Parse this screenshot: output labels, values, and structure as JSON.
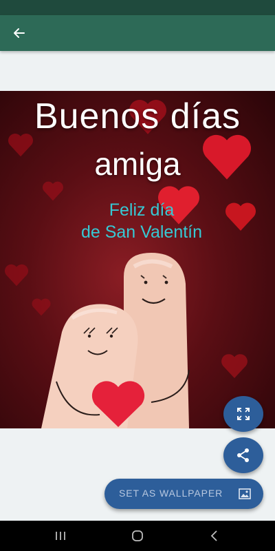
{
  "app_bar": {
    "back_icon": "arrow-back-icon",
    "color": "#2d6a57"
  },
  "image": {
    "line1": "Buenos días",
    "line2": "amiga",
    "line3": "Feliz día",
    "line4": "de San Valentín"
  },
  "actions": {
    "fullscreen_icon": "fullscreen-icon",
    "share_icon": "share-icon",
    "set_wallpaper_label": "SET AS WALLPAPER",
    "wallpaper_icon": "wallpaper-icon",
    "button_color": "#2d5e9a"
  },
  "nav": {
    "recents_icon": "recents-icon",
    "home_icon": "home-icon",
    "back_icon": "back-icon"
  }
}
